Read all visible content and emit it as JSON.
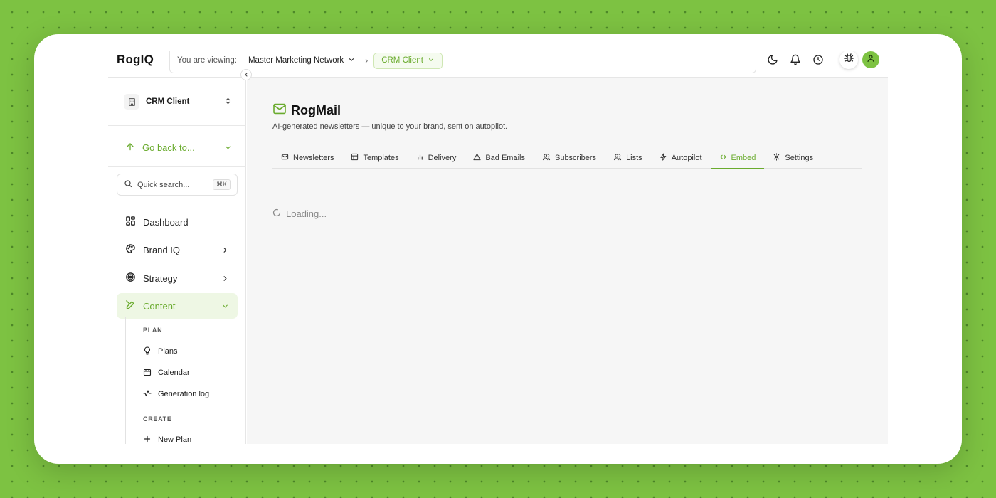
{
  "header": {
    "logo": "RogIQ",
    "viewing_label": "You are viewing:",
    "network": "Master Marketing Network",
    "crumb_sep": "›",
    "client": "CRM Client",
    "icons": [
      "moon-icon",
      "bell-icon",
      "clock-icon",
      "bug-icon",
      "user-icon"
    ]
  },
  "sidebar": {
    "client_name": "CRM Client",
    "go_back": "Go back to...",
    "search": {
      "placeholder": "Quick search...",
      "shortcut": "⌘K"
    },
    "nav": [
      {
        "label": "Dashboard",
        "icon": "dashboard-icon"
      },
      {
        "label": "Brand IQ",
        "icon": "palette-icon"
      },
      {
        "label": "Strategy",
        "icon": "target-icon"
      },
      {
        "label": "Content",
        "icon": "pen-icon",
        "active": true
      }
    ],
    "sections": {
      "plan": {
        "label": "PLAN",
        "items": [
          {
            "label": "Plans",
            "icon": "lightbulb-icon"
          },
          {
            "label": "Calendar",
            "icon": "calendar-icon"
          },
          {
            "label": "Generation log",
            "icon": "activity-icon"
          }
        ]
      },
      "create": {
        "label": "CREATE",
        "items": [
          {
            "label": "New Plan",
            "icon": "plus-icon"
          }
        ]
      }
    }
  },
  "main": {
    "title": "RogMail",
    "subtitle": "AI-generated newsletters — unique to your brand, sent on autopilot.",
    "tabs": [
      {
        "label": "Newsletters",
        "icon": "mail-icon"
      },
      {
        "label": "Templates",
        "icon": "template-icon"
      },
      {
        "label": "Delivery",
        "icon": "bar-chart-icon"
      },
      {
        "label": "Bad Emails",
        "icon": "warning-icon"
      },
      {
        "label": "Subscribers",
        "icon": "users-icon"
      },
      {
        "label": "Lists",
        "icon": "users-icon"
      },
      {
        "label": "Autopilot",
        "icon": "zap-icon"
      },
      {
        "label": "Embed",
        "icon": "code-icon",
        "active": true
      },
      {
        "label": "Settings",
        "icon": "gear-icon"
      }
    ],
    "loading": "Loading..."
  },
  "colors": {
    "accent": "#6aab2e",
    "background": "#7dc242"
  }
}
